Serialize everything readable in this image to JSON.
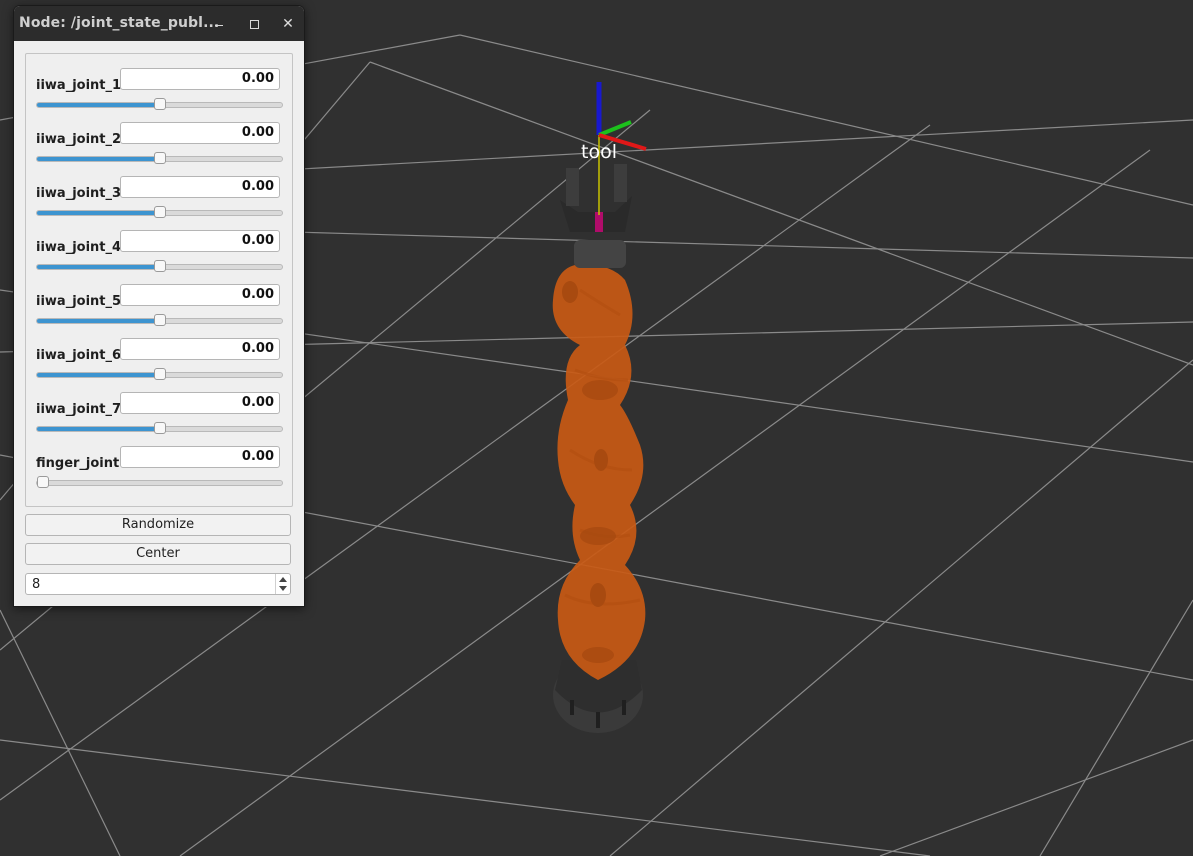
{
  "window": {
    "title": "Node: /joint_state_publ..."
  },
  "joints": [
    {
      "name": "iiwa_joint_1",
      "value": "0.00",
      "slider_fraction": 0.5
    },
    {
      "name": "iiwa_joint_2",
      "value": "0.00",
      "slider_fraction": 0.5
    },
    {
      "name": "iiwa_joint_3",
      "value": "0.00",
      "slider_fraction": 0.5
    },
    {
      "name": "iiwa_joint_4",
      "value": "0.00",
      "slider_fraction": 0.5
    },
    {
      "name": "iiwa_joint_5",
      "value": "0.00",
      "slider_fraction": 0.5
    },
    {
      "name": "iiwa_joint_6",
      "value": "0.00",
      "slider_fraction": 0.5
    },
    {
      "name": "iiwa_joint_7",
      "value": "0.00",
      "slider_fraction": 0.5
    },
    {
      "name": "finger_joint",
      "value": "0.00",
      "slider_fraction": 0.0
    }
  ],
  "buttons": {
    "randomize": "Randomize",
    "center": "Center"
  },
  "spinbox": {
    "value": "8"
  },
  "viewport": {
    "frame_label": "tool",
    "background_color": "#303030",
    "grid_color": "#9a9a9a",
    "robot_color": "#d9661e",
    "axis_colors": {
      "x": "#e01818",
      "y": "#1cc01c",
      "z": "#1818d0"
    }
  },
  "colors": {
    "slider_fill": "#3d94d0",
    "titlebar": "#2c2c2c"
  }
}
